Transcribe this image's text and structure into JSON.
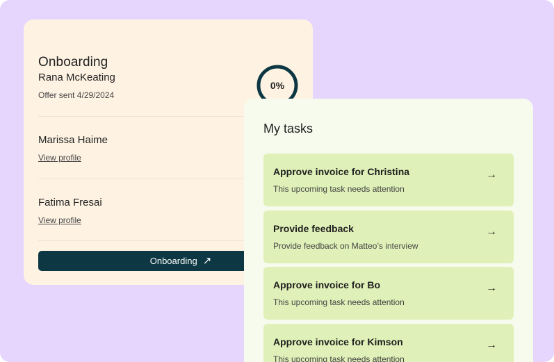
{
  "onboarding": {
    "title": "Onboarding",
    "candidates": [
      {
        "name": "Rana McKeating",
        "detail": "Offer sent 4/29/2024"
      },
      {
        "name": "Marissa Haime",
        "link": "View profile"
      },
      {
        "name": "Fatima Fresai",
        "link": "View profile"
      }
    ],
    "progress": {
      "label": "0%",
      "value": 0
    },
    "button_label": "Onboarding",
    "button_icon": "arrow-up-right-icon"
  },
  "tasks": {
    "title": "My tasks",
    "items": [
      {
        "title": "Approve invoice for Christina",
        "subtitle": "This upcoming task needs attention"
      },
      {
        "title": "Provide feedback",
        "subtitle": "Provide feedback on Matteo’s interview"
      },
      {
        "title": "Approve invoice for Bo",
        "subtitle": "This upcoming task needs attention"
      },
      {
        "title": "Approve invoice for Kimson",
        "subtitle": "This upcoming task needs attention"
      }
    ],
    "item_icon": "arrow-right-icon"
  },
  "colors": {
    "background": "#e6d5fd",
    "onboarding_card": "#fef3e3",
    "tasks_card": "#f7fbee",
    "task_item": "#dff1b8",
    "primary_button": "#0c3743"
  }
}
